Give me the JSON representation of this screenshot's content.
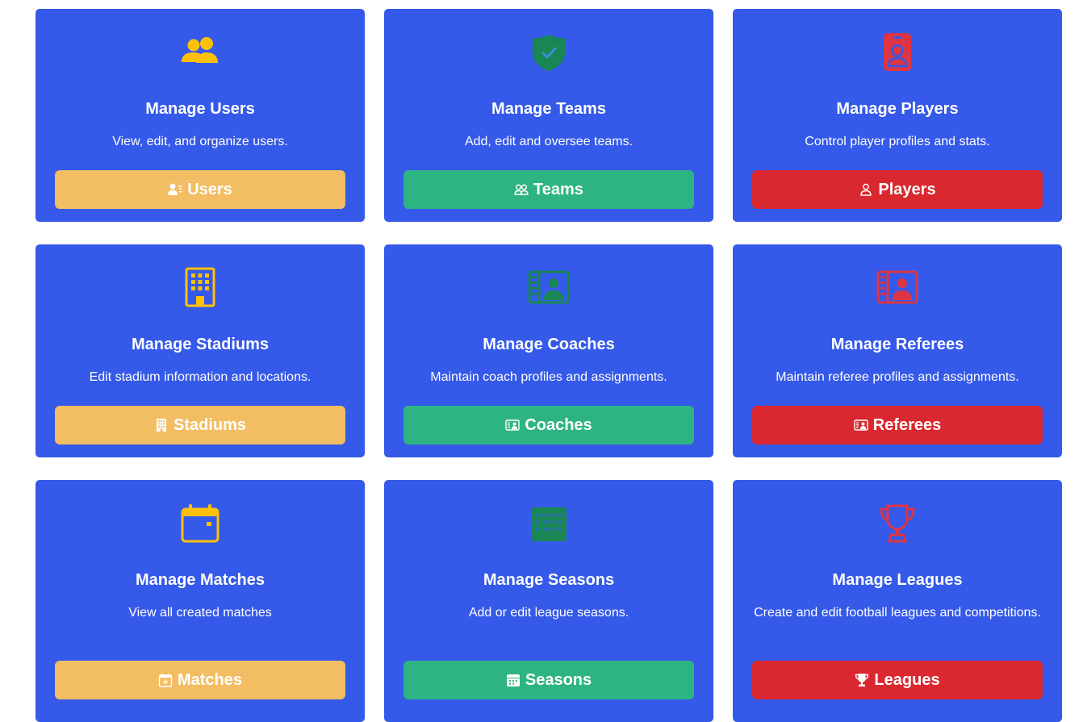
{
  "colors": {
    "card_bg": "#3559e8",
    "yellow_icon": "#ffc107",
    "green_icon": "#198754",
    "red_icon": "#dc3545",
    "yellow_button": "#f3bd63",
    "green_button": "#2eb482",
    "red_button": "#d9282f"
  },
  "cards": [
    {
      "title": "Manage Users",
      "description": "View, edit, and organize users.",
      "button_label": "Users",
      "icon": "people-icon",
      "button_icon": "person-lines-icon"
    },
    {
      "title": "Manage Teams",
      "description": "Add, edit and oversee teams.",
      "button_label": "Teams",
      "icon": "shield-check-icon",
      "button_icon": "people-outline-icon"
    },
    {
      "title": "Manage Players",
      "description": "Control player profiles and stats.",
      "button_label": "Players",
      "icon": "badge-icon",
      "button_icon": "person-outline-icon"
    },
    {
      "title": "Manage Stadiums",
      "description": "Edit stadium information and locations.",
      "button_label": "Stadiums",
      "icon": "building-icon",
      "button_icon": "building-icon"
    },
    {
      "title": "Manage Coaches",
      "description": "Maintain coach profiles and assignments.",
      "button_label": "Coaches",
      "icon": "person-vcard-icon",
      "button_icon": "person-vcard-icon"
    },
    {
      "title": "Manage Referees",
      "description": "Maintain referee profiles and assignments.",
      "button_label": "Referees",
      "icon": "person-vcard-icon",
      "button_icon": "person-vcard-icon"
    },
    {
      "title": "Manage Matches",
      "description": "View all created matches",
      "button_label": "Matches",
      "icon": "calendar-icon",
      "button_icon": "calendar-plus-icon"
    },
    {
      "title": "Manage Seasons",
      "description": "Add or edit league seasons.",
      "button_label": "Seasons",
      "icon": "calendar-week-icon",
      "button_icon": "calendar-week-icon"
    },
    {
      "title": "Manage Leagues",
      "description": "Create and edit football leagues and competitions.",
      "button_label": "Leagues",
      "icon": "trophy-icon",
      "button_icon": "trophy-icon"
    }
  ]
}
